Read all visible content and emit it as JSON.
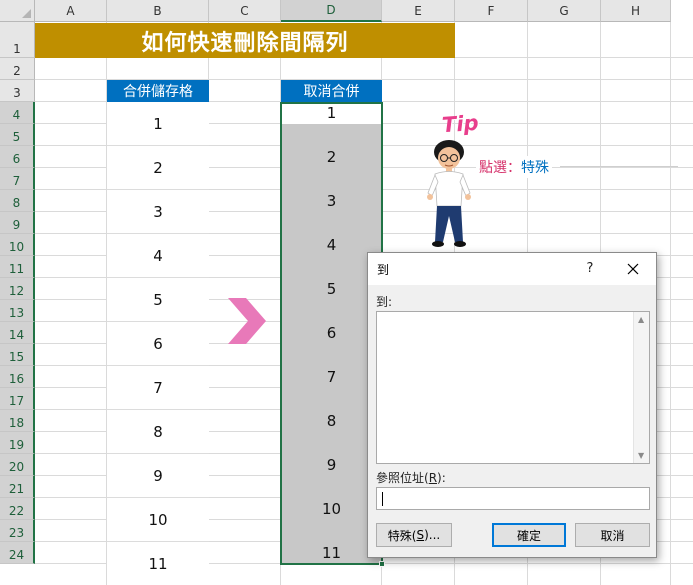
{
  "columns": [
    "A",
    "B",
    "C",
    "D",
    "E",
    "F",
    "G",
    "H"
  ],
  "selected_column": "D",
  "rows": [
    "1",
    "2",
    "3",
    "4",
    "5",
    "6",
    "7",
    "8",
    "9",
    "10",
    "11",
    "12",
    "13",
    "14",
    "15",
    "16",
    "17",
    "18",
    "19",
    "20",
    "21",
    "22",
    "23",
    "24"
  ],
  "title": "如何快速刪除間隔列",
  "col_b_header": "合併儲存格",
  "col_d_header": "取消合併",
  "col_b_values": [
    "1",
    "2",
    "3",
    "4",
    "5",
    "6",
    "7",
    "8",
    "9",
    "10",
    "11"
  ],
  "col_d_values": [
    "1",
    "2",
    "3",
    "4",
    "5",
    "6",
    "7",
    "8",
    "9",
    "10",
    "11"
  ],
  "tip": {
    "word": "Tip",
    "callout_prefix": "點選：",
    "callout_target": "特殊"
  },
  "colors": {
    "title_bg": "#bf8f00",
    "header_bg": "#0070c0",
    "selection": "#217346",
    "arrow": "#e879b9"
  },
  "dialog": {
    "title": "到",
    "help": "?",
    "goto_label": "到:",
    "reference_label_pre": "參照位址(",
    "reference_label_key": "R",
    "reference_label_post": "):",
    "reference_value": "",
    "special_button_pre": "特殊(",
    "special_button_key": "S",
    "special_button_post": ")...",
    "ok_button": "確定",
    "cancel_button": "取消"
  }
}
